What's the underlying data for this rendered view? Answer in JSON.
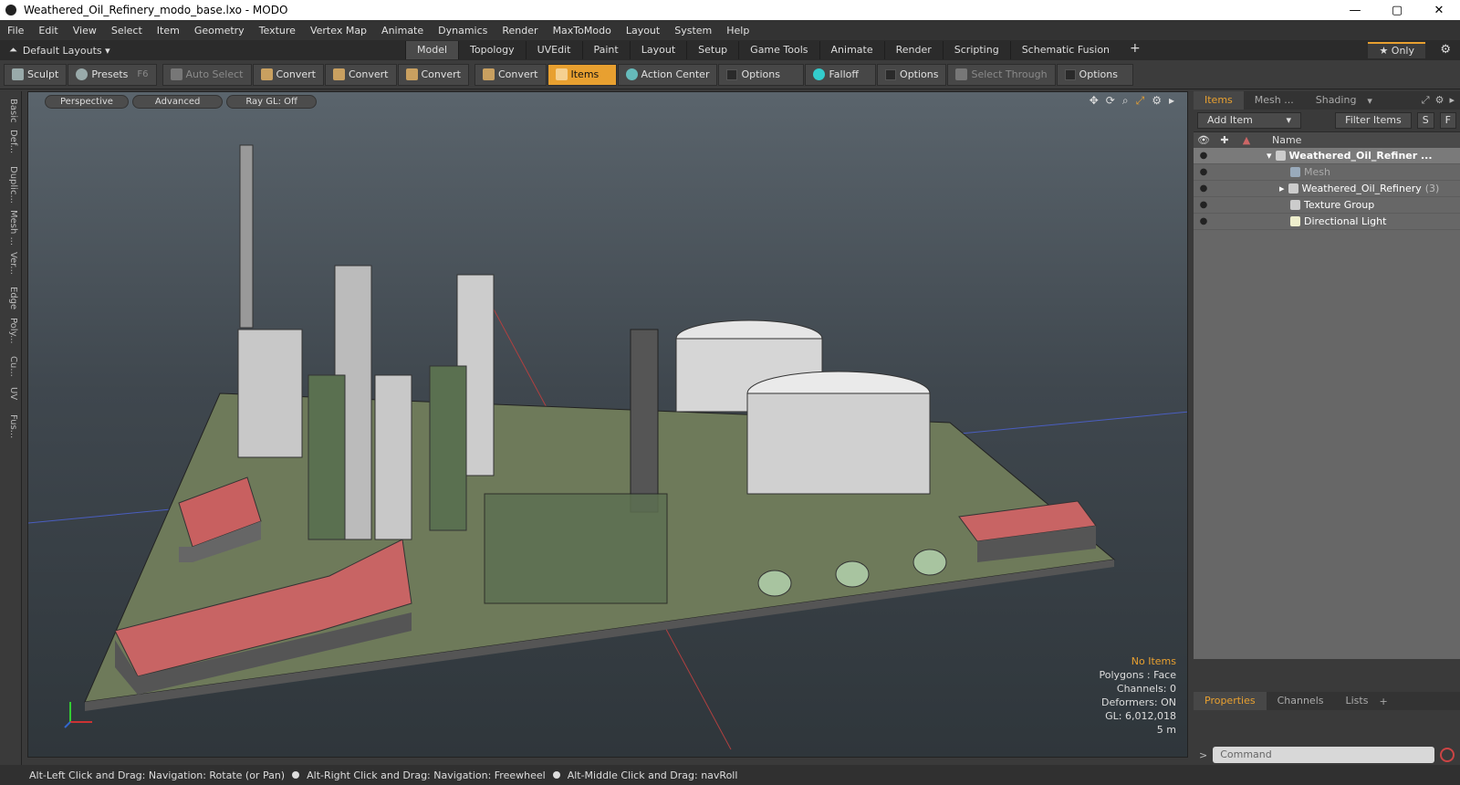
{
  "window": {
    "title": "Weathered_Oil_Refinery_modo_base.lxo - MODO",
    "min": "—",
    "max": "▢",
    "close": "✕"
  },
  "menu": [
    "File",
    "Edit",
    "View",
    "Select",
    "Item",
    "Geometry",
    "Texture",
    "Vertex Map",
    "Animate",
    "Dynamics",
    "Render",
    "MaxToModo",
    "Layout",
    "System",
    "Help"
  ],
  "modebar": {
    "layouts": "Default Layouts ▾",
    "tabs": [
      "Model",
      "Topology",
      "UVEdit",
      "Paint",
      "Layout",
      "Setup",
      "Game Tools",
      "Animate",
      "Render",
      "Scripting",
      "Schematic Fusion"
    ],
    "active_tab": "Model",
    "only": "★  Only"
  },
  "toolbar": {
    "sculpt": "Sculpt",
    "presets": "Presets",
    "presets_key": "F6",
    "auto_select": "Auto Select",
    "convert1": "Convert",
    "convert2": "Convert",
    "convert3": "Convert",
    "convert4": "Convert",
    "items": "Items",
    "action_center": "Action Center",
    "options1": "Options",
    "falloff": "Falloff",
    "options2": "Options",
    "select_through": "Select Through",
    "options3": "Options"
  },
  "left_tabs": [
    "Basic",
    "Def...",
    "Duplic...",
    "Mesh ...",
    "Ver...",
    "Edge",
    "Poly...",
    "Cu...",
    "UV",
    "Fus..."
  ],
  "viewport": {
    "perspective": "Perspective",
    "advanced": "Advanced",
    "raygl": "Ray GL: Off",
    "info": {
      "no_items": "No Items",
      "polygons": "Polygons : Face",
      "channels": "Channels: 0",
      "deformers": "Deformers: ON",
      "gl": "GL: 6,012,018",
      "scale": "5 m"
    }
  },
  "status": {
    "hint1": "Alt-Left Click and Drag: Navigation: Rotate (or Pan)",
    "hint2": "Alt-Right Click and Drag: Navigation: Freewheel",
    "hint3": "Alt-Middle Click and Drag: navRoll"
  },
  "panel": {
    "tabs": [
      "Items",
      "Mesh ...",
      "Shading"
    ],
    "add_item": "Add Item",
    "filter_items": "Filter Items",
    "s": "S",
    "f": "F",
    "name_col": "Name",
    "rows": [
      {
        "name": "Weathered_Oil_Refiner ...",
        "count": ""
      },
      {
        "name": "Mesh",
        "count": ""
      },
      {
        "name": "Weathered_Oil_Refinery",
        "count": "(3)"
      },
      {
        "name": "Texture Group",
        "count": ""
      },
      {
        "name": "Directional Light",
        "count": ""
      }
    ],
    "bottom_tabs": [
      "Properties",
      "Channels",
      "Lists"
    ],
    "command_placeholder": "Command"
  }
}
